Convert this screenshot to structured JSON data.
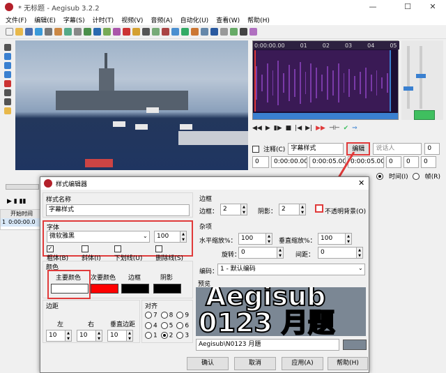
{
  "window": {
    "title": "* 无标题 - Aegisub 3.2.2",
    "controls": {
      "min": "—",
      "max": "☐",
      "close": "✕"
    }
  },
  "menu": [
    "文件(F)",
    "编辑(E)",
    "字幕(S)",
    "计时(T)",
    "视频(V)",
    "音频(A)",
    "自动化(U)",
    "查看(W)",
    "帮助(H)"
  ],
  "audio_ruler": [
    "0:00:00.00",
    "01",
    "02",
    "03",
    "04",
    "05"
  ],
  "edit": {
    "comment_label": "注释(C)",
    "style_value": "字幕样式",
    "edit_button": "编辑",
    "actor_placeholder": "说话人",
    "effect_value": "0",
    "layer": "0",
    "start": "0:00:00.00",
    "end": "0:00:05.00",
    "duration": "0:00:05.00",
    "margin_l": "0",
    "margin_r": "0",
    "margin_v": "0",
    "time_radio": "时间(I)",
    "frame_radio": "帧(R)"
  },
  "grid": {
    "header": "开始时间",
    "row_num": "1",
    "row_start": "0:00:00.0"
  },
  "dialog": {
    "title": "样式编辑器",
    "close": "✕",
    "style_name": {
      "label": "样式名称",
      "value": "字幕样式"
    },
    "font": {
      "label": "字体",
      "name": "微软雅黑",
      "size": "100",
      "bold": "粗体(B)",
      "italic": "斜体(I)",
      "underline": "下划线(U)",
      "strike": "删除线(S)",
      "bold_checked": true
    },
    "colors": {
      "label": "颜色",
      "primary": "主要颜色",
      "secondary": "次要颜色",
      "outline": "边框",
      "shadow": "阴影",
      "primary_color": "#ffffff",
      "secondary_color": "#ff0000",
      "outline_color": "#000000",
      "shadow_color": "#000000"
    },
    "margins": {
      "label": "边距",
      "left": "左",
      "right": "右",
      "vertical": "垂直边距",
      "left_val": "10",
      "right_val": "10",
      "vertical_val": "10"
    },
    "alignment": {
      "label": "对齐",
      "options": [
        "7",
        "8",
        "9",
        "4",
        "5",
        "6",
        "1",
        "2",
        "3"
      ],
      "selected": "2"
    },
    "border": {
      "label": "边框",
      "outline_label": "边框：",
      "outline_val": "2",
      "shadow_label": "阴影：",
      "shadow_val": "2",
      "opaque_label": "不透明背景(O)"
    },
    "misc": {
      "label": "杂项",
      "scale_x_label": "水平缩放%：",
      "scale_x": "100",
      "scale_y_label": "垂直缩放%：",
      "scale_y": "100",
      "rotation_label": "旋转：",
      "rotation": "0",
      "spacing_label": "间距：",
      "spacing": "0",
      "encoding_label": "编码：",
      "encoding": "1 - 默认编码"
    },
    "preview": {
      "label": "预览",
      "line1": "Aegisub",
      "line2": "0123 月題",
      "sample_text": "Aegisub\\N0123 月題"
    },
    "buttons": {
      "ok": "确认",
      "cancel": "取消",
      "apply": "应用(A)",
      "help": "帮助(H)"
    }
  },
  "accent": {
    "red": "#e03a3a",
    "blue": "#3a80d0",
    "green": "#3fbf5f"
  }
}
